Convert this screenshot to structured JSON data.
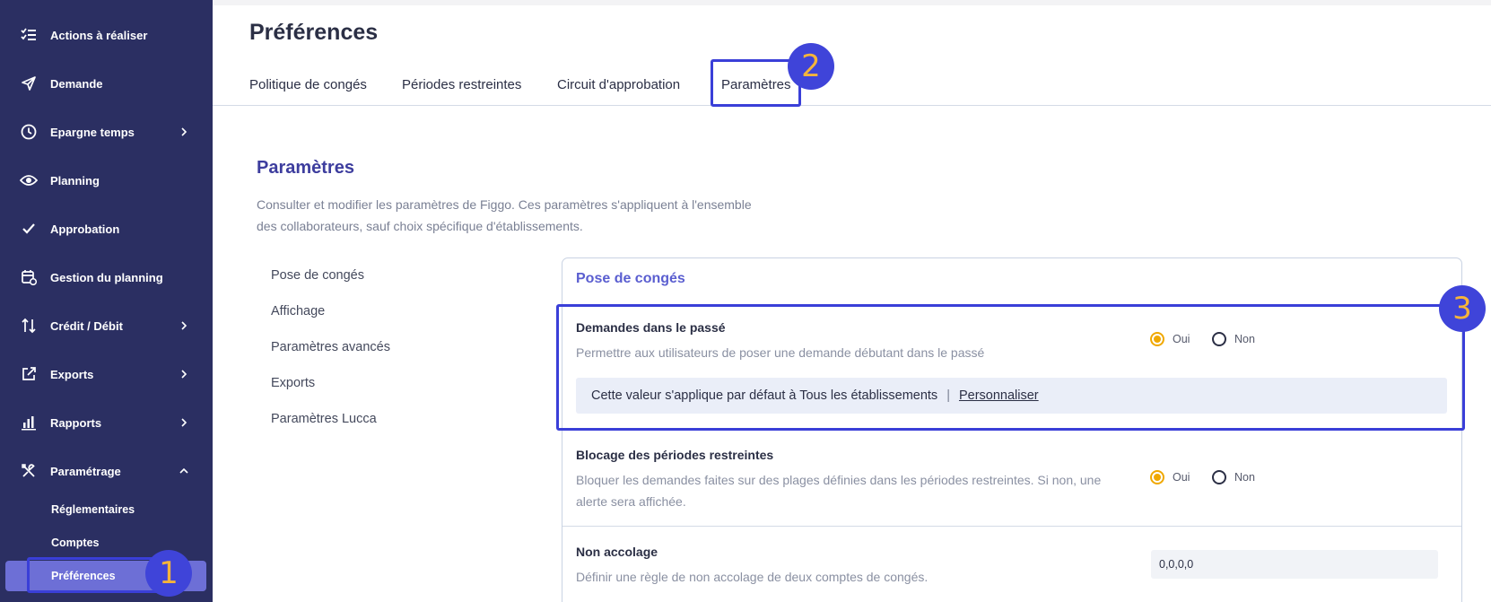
{
  "sidebar": {
    "items": [
      {
        "label": "Actions à réaliser",
        "icon": "checklist-icon",
        "has_chevron": false
      },
      {
        "label": "Demande",
        "icon": "paper-plane-icon",
        "has_chevron": false
      },
      {
        "label": "Epargne temps",
        "icon": "clock-icon",
        "has_chevron": true
      },
      {
        "label": "Planning",
        "icon": "eye-icon",
        "has_chevron": false
      },
      {
        "label": "Approbation",
        "icon": "check-icon",
        "has_chevron": false
      },
      {
        "label": "Gestion du planning",
        "icon": "calendar-gear-icon",
        "has_chevron": false
      },
      {
        "label": "Crédit / Débit",
        "icon": "up-down-arrows-icon",
        "has_chevron": true
      },
      {
        "label": "Exports",
        "icon": "external-link-icon",
        "has_chevron": true
      },
      {
        "label": "Rapports",
        "icon": "bar-chart-icon",
        "has_chevron": true
      },
      {
        "label": "Paramétrage",
        "icon": "tools-icon",
        "has_chevron": true,
        "expanded": true
      }
    ],
    "subitems": [
      {
        "label": "Réglementaires"
      },
      {
        "label": "Comptes"
      },
      {
        "label": "Préférences",
        "active": true
      }
    ]
  },
  "header": {
    "title": "Préférences",
    "tabs": [
      {
        "label": "Politique de congés"
      },
      {
        "label": "Périodes restreintes"
      },
      {
        "label": "Circuit d'approbation"
      },
      {
        "label": "Paramètres",
        "active": true
      }
    ]
  },
  "annotations": [
    "1",
    "2",
    "3"
  ],
  "section": {
    "title": "Paramètres",
    "description": "Consulter et modifier les paramètres de Figgo. Ces paramètres s'appliquent à l'ensemble des collaborateurs, sauf choix spécifique d'établissements."
  },
  "subnav": [
    "Pose de congés",
    "Affichage",
    "Paramètres avancés",
    "Exports",
    "Paramètres Lucca"
  ],
  "card": {
    "title": "Pose de congés",
    "rows": [
      {
        "title": "Demandes dans le passé",
        "description": "Permettre aux utilisateurs de poser une demande débutant dans le passé",
        "options": [
          "Oui",
          "Non"
        ],
        "selected": "Oui",
        "info": {
          "text": "Cette valeur s'applique par défaut à Tous les établissements",
          "separator": "|",
          "link": "Personnaliser"
        }
      },
      {
        "title": "Blocage des périodes restreintes",
        "description": "Bloquer les demandes faites sur des plages définies dans les périodes restreintes. Si non, une alerte sera affichée.",
        "options": [
          "Oui",
          "Non"
        ],
        "selected": "Oui"
      },
      {
        "title": "Non accolage",
        "description": "Définir une règle de non accolage de deux comptes de congés.",
        "value": "0,0,0,0"
      }
    ]
  },
  "colors": {
    "sidebar_bg": "#2b2f62",
    "active_item": "#6d6fd6",
    "accent": "#3d3d9e",
    "radio_selected": "#f0a800",
    "annotation": "#3f44d9"
  }
}
